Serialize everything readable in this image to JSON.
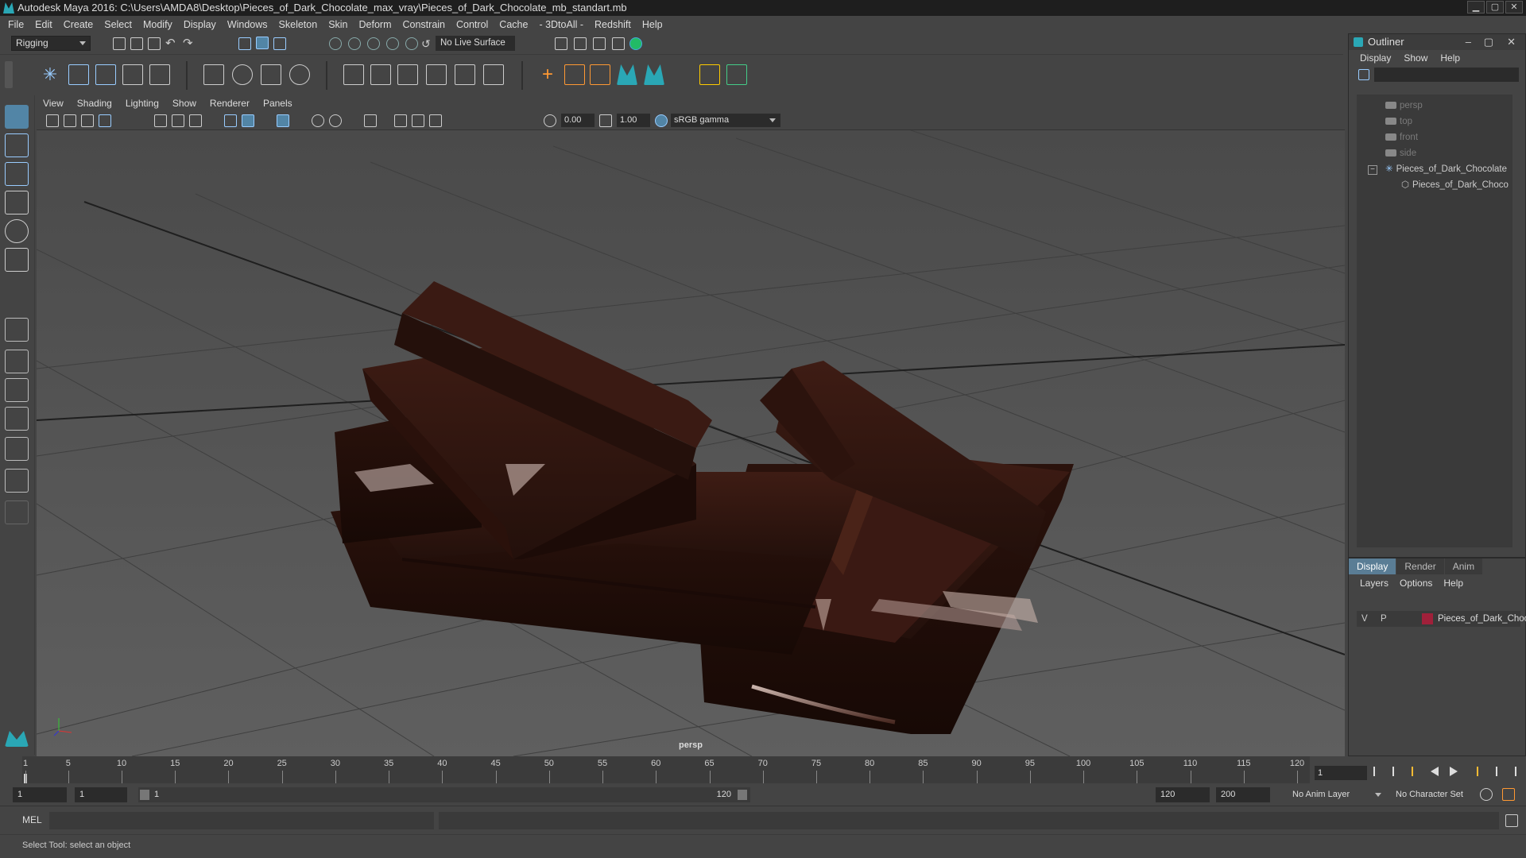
{
  "window": {
    "title": "Autodesk Maya 2016: C:\\Users\\AMDA8\\Desktop\\Pieces_of_Dark_Chocolate_max_vray\\Pieces_of_Dark_Chocolate_mb_standart.mb",
    "min": "▁",
    "max": "▢",
    "close": "✕"
  },
  "menu": [
    "File",
    "Edit",
    "Create",
    "Select",
    "Modify",
    "Display",
    "Windows",
    "Skeleton",
    "Skin",
    "Deform",
    "Constrain",
    "Control",
    "Cache",
    "- 3DtoAll -",
    "Redshift",
    "Help"
  ],
  "toolbar": {
    "mode": "Rigging",
    "live_surface": "No Live Surface"
  },
  "viewport": {
    "menu": [
      "View",
      "Shading",
      "Lighting",
      "Show",
      "Renderer",
      "Panels"
    ],
    "exposure": "0.00",
    "gamma": "1.00",
    "color_space": "sRGB gamma",
    "camera": "persp"
  },
  "outliner": {
    "title": "Outliner",
    "menu": [
      "Display",
      "Show",
      "Help"
    ],
    "items": [
      {
        "label": "persp",
        "kind": "camera"
      },
      {
        "label": "top",
        "kind": "camera"
      },
      {
        "label": "front",
        "kind": "camera"
      },
      {
        "label": "side",
        "kind": "camera"
      },
      {
        "label": "Pieces_of_Dark_Chocolate",
        "kind": "group",
        "expander": "−"
      },
      {
        "label": "Pieces_of_Dark_Choco",
        "kind": "mesh"
      }
    ]
  },
  "layers": {
    "tabs": [
      "Display",
      "Render",
      "Anim"
    ],
    "menu": [
      "Layers",
      "Options",
      "Help"
    ],
    "row": {
      "v": "V",
      "p": "P",
      "name": "Pieces_of_Dark_Choco",
      "color": "#a0203a"
    }
  },
  "timeline": {
    "ticks": [
      "1",
      "5",
      "10",
      "15",
      "20",
      "25",
      "30",
      "35",
      "40",
      "45",
      "50",
      "55",
      "60",
      "65",
      "70",
      "75",
      "80",
      "85",
      "90",
      "95",
      "100",
      "105",
      "110",
      "115",
      "120"
    ],
    "current_frame": "1"
  },
  "range": {
    "start": "1",
    "playback_start": "1",
    "slider_start": "1",
    "slider_end": "120",
    "playback_end": "120",
    "end": "200",
    "anim_layer": "No Anim Layer",
    "char_set": "No Character Set"
  },
  "cmd": {
    "label": "MEL"
  },
  "status": {
    "help": "Select Tool: select an object"
  }
}
